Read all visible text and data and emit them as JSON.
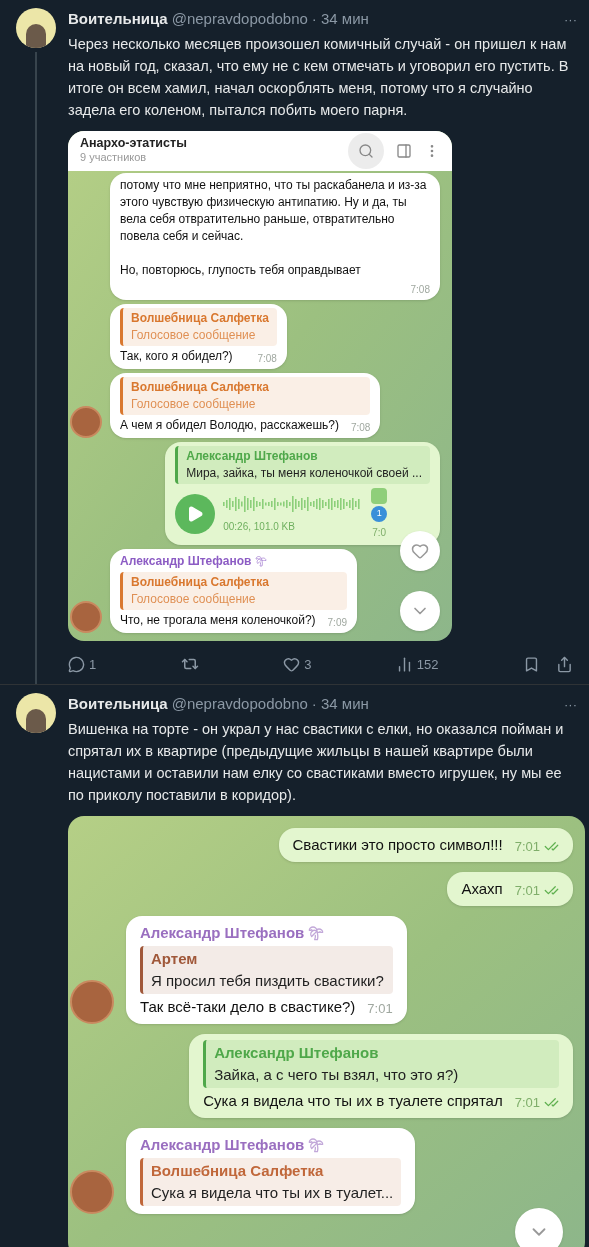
{
  "tweets": [
    {
      "author": "Воительница",
      "handle": "@nepravdopodobno",
      "time": "· 34 мин",
      "more": "···",
      "text": "Через несколько месяцев произошел комичный случай - он пришел к нам на новый год, сказал, что ему не с кем отмечать и уговорил его пустить. В итоге он всем хамил, начал оскорблять меня, потому что я случайно задела его коленом, пытался побить моего парня.",
      "thread": true,
      "chat": {
        "header": {
          "title": "Анархо-этатисты",
          "subtitle": "9 участников"
        },
        "messages": [
          {
            "kind": "text",
            "outgoing": false,
            "avatar": false,
            "text": "потому что мне неприятно, что ты раскабанела и из-за этого чувствую физическую антипатию. Ну и да, ты вела себя отвратительно раньше, отвратительно повела себя и сейчас.\n\nНо, повторюсь, глупость тебя оправдывает",
            "time": "7:08"
          },
          {
            "kind": "text",
            "outgoing": false,
            "avatar": false,
            "reply": {
              "author": "Волшебница Салфетка",
              "text": "Голосовое сообщение",
              "kind": "voice",
              "color": "#d9782f"
            },
            "text": "Так, кого я обидел?)",
            "time": "7:08"
          },
          {
            "kind": "text",
            "outgoing": false,
            "avatar": true,
            "reply": {
              "author": "Волшебница Салфетка",
              "text": "Голосовое сообщение",
              "kind": "voice",
              "color": "#d9782f"
            },
            "text": "А чем я обидел Володю, расскажешь?)",
            "time": "7:08"
          },
          {
            "kind": "voice",
            "outgoing": true,
            "reply": {
              "author": "Александр Штефанов",
              "text": "Мира, зайка, ты меня коленочкой своей ...",
              "kind": "text",
              "color": "#4fa84a"
            },
            "duration": "00:26, 101.0 KB",
            "time": "7:0",
            "reaction_count": "1"
          },
          {
            "kind": "text",
            "outgoing": false,
            "avatar": true,
            "sender": {
              "name": "Александр Штефанов",
              "color": "#8c5cc4",
              "palm": true
            },
            "reply": {
              "author": "Волшебница Салфетка",
              "text": "Голосовое сообщение",
              "kind": "voice",
              "color": "#d9782f"
            },
            "text": "Что, не трогала меня коленочкой?)",
            "time": "7:09"
          }
        ]
      },
      "actions": {
        "replies": "1",
        "likes": "3",
        "views": "152"
      }
    },
    {
      "author": "Воительница",
      "handle": "@nepravdopodobno",
      "time": "· 34 мин",
      "more": "···",
      "text": "Вишенка на торте - он украл у нас свастики с елки, но оказался пойман и спрятал их в квартире (предыдущие жильцы в нашей квартире были нацистами и оставили нам елку со свастиками вместо игрушек, ну мы ее по приколу поставили в коридор).",
      "thread": false,
      "chat": {
        "messages": [
          {
            "kind": "text",
            "outgoing": true,
            "text": "Свастики это просто символ!!!",
            "time": "7:01",
            "read": true
          },
          {
            "kind": "text",
            "outgoing": true,
            "text": "Ахахп",
            "time": "7:01",
            "read": true
          },
          {
            "kind": "text",
            "outgoing": false,
            "avatar": true,
            "sender": {
              "name": "Александр Штефанов",
              "color": "#9a6fc0",
              "palm": true
            },
            "reply": {
              "author": "Артем",
              "text": "Я просил тебя пиздить свастики?",
              "kind": "text",
              "color": "#a0583a"
            },
            "text": "Так всё-таки дело в свастике?)",
            "time": "7:01"
          },
          {
            "kind": "text",
            "outgoing": true,
            "reply": {
              "author": "Александр Штефанов",
              "text": "Зайка, а с чего ты взял, что это я?)",
              "kind": "text",
              "color": "#4fa84a"
            },
            "text": "Сука я видела что ты их в туалете спрятал",
            "time": "7:01",
            "read": true
          },
          {
            "kind": "text",
            "outgoing": false,
            "avatar": true,
            "sender": {
              "name": "Александр Штефанов",
              "color": "#9a6fc0",
              "palm": true
            },
            "reply": {
              "author": "Волшебница Салфетка",
              "text": "Сука я видела что ты их в туалет...",
              "kind": "text",
              "color": "#c0673a"
            }
          }
        ]
      }
    }
  ]
}
